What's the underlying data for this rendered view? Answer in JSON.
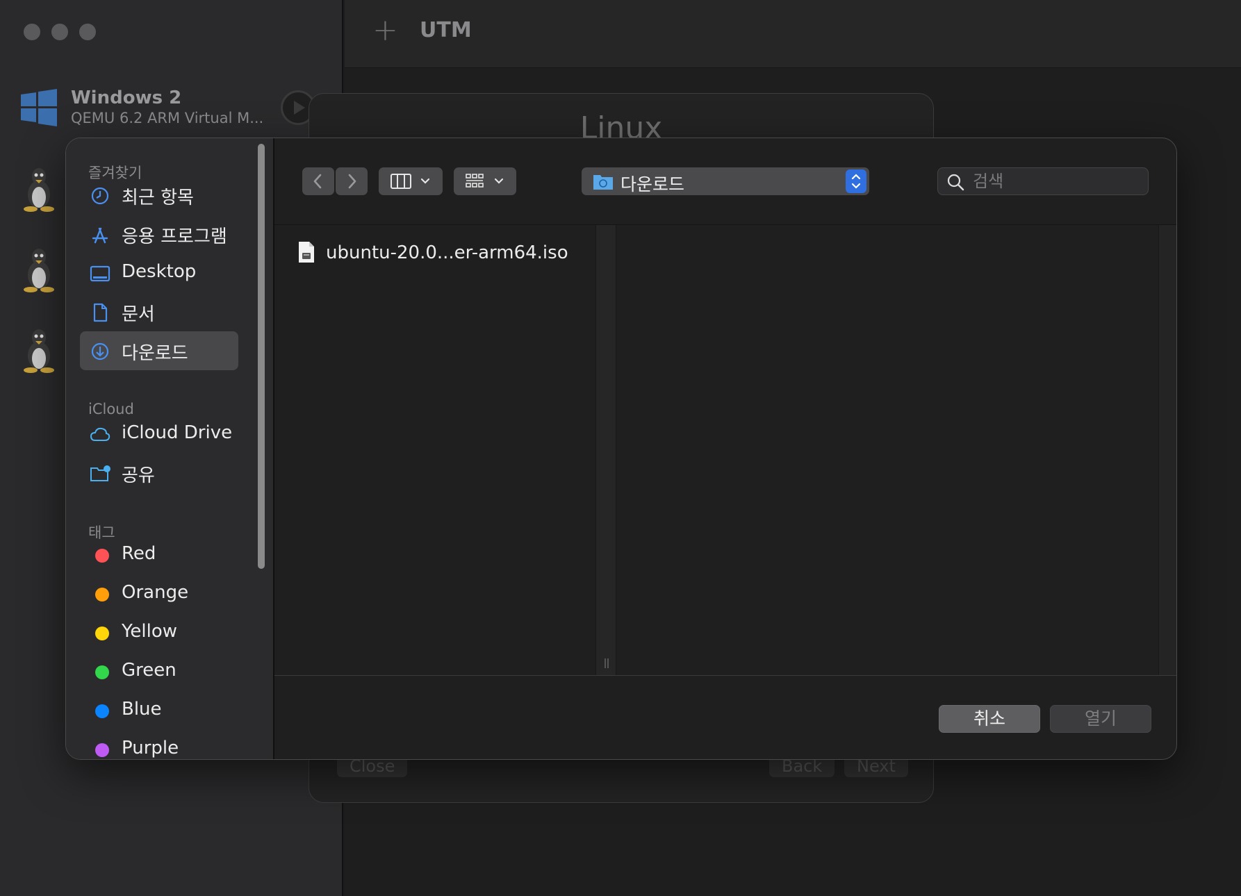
{
  "app": {
    "title": "UTM",
    "add_glyph": "+",
    "vm_list": [
      {
        "name": "Windows 2",
        "subtitle": "QEMU 6.2 ARM Virtual M...",
        "icon": "windows-logo-icon"
      },
      {
        "name": "",
        "subtitle": "",
        "icon": "linux-tux-icon"
      },
      {
        "name": "",
        "subtitle": "",
        "icon": "linux-tux-icon"
      },
      {
        "name": "",
        "subtitle": "",
        "icon": "linux-tux-icon"
      }
    ]
  },
  "wizard": {
    "title": "Linux",
    "buttons": {
      "close": "Close",
      "back": "Back",
      "next": "Next"
    }
  },
  "dialog": {
    "sidebar": {
      "favorites_heading": "즐겨찾기",
      "favorites": [
        {
          "label": "최근 항목",
          "icon": "clock-icon"
        },
        {
          "label": "응용 프로그램",
          "icon": "applications-icon"
        },
        {
          "label": "Desktop",
          "icon": "desktop-icon"
        },
        {
          "label": "문서",
          "icon": "document-icon"
        },
        {
          "label": "다운로드",
          "icon": "download-icon",
          "selected": true
        }
      ],
      "icloud_heading": "iCloud",
      "icloud": [
        {
          "label": "iCloud Drive",
          "icon": "cloud-icon"
        },
        {
          "label": "공유",
          "icon": "shared-folder-icon"
        }
      ],
      "tags_heading": "태그",
      "tags": [
        {
          "label": "Red",
          "color": "#ff5257"
        },
        {
          "label": "Orange",
          "color": "#ff9f0a"
        },
        {
          "label": "Yellow",
          "color": "#ffd60a"
        },
        {
          "label": "Green",
          "color": "#32d74b"
        },
        {
          "label": "Blue",
          "color": "#0a84ff"
        },
        {
          "label": "Purple",
          "color": "#bf5af2"
        }
      ]
    },
    "toolbar": {
      "location": "다운로드",
      "search_placeholder": "검색"
    },
    "files": [
      {
        "name": "ubuntu-20.0...er-arm64.iso",
        "icon": "iso-file-icon"
      }
    ],
    "buttons": {
      "cancel": "취소",
      "open": "열기"
    }
  },
  "colors": {
    "accent": "#2f6fe0",
    "selected_row": "#48484a"
  }
}
